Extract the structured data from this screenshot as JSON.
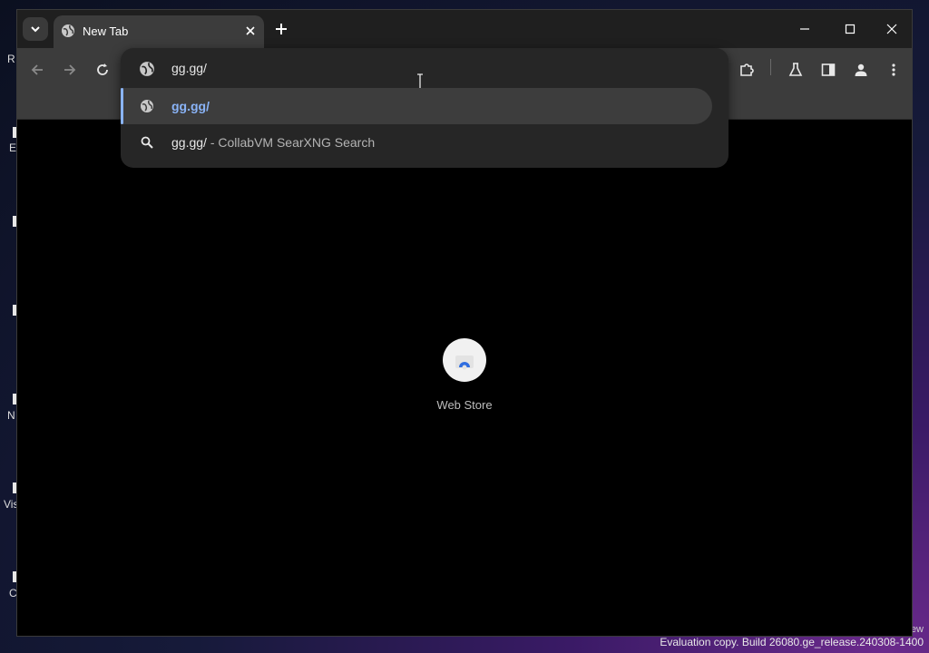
{
  "desktop": {
    "fragments": [
      "R",
      "E",
      "N",
      "Vis",
      "C"
    ],
    "watermark_top": "ew",
    "watermark": "Evaluation copy. Build 26080.ge_release.240308-1400"
  },
  "tab": {
    "title": "New Tab"
  },
  "omnibox": {
    "input_value": "gg.gg/",
    "suggestions": [
      {
        "text": "gg.gg/",
        "desc": "",
        "icon": "globe-icon"
      },
      {
        "text": "gg.gg/",
        "desc": " - CollabVM SearXNG Search",
        "icon": "search-icon"
      }
    ]
  },
  "ntp": {
    "shortcut_label": "Web Store"
  },
  "colors": {
    "accent": "#8ab4f8",
    "tab_bg": "#3c3c3c",
    "page_bg": "#000000"
  }
}
